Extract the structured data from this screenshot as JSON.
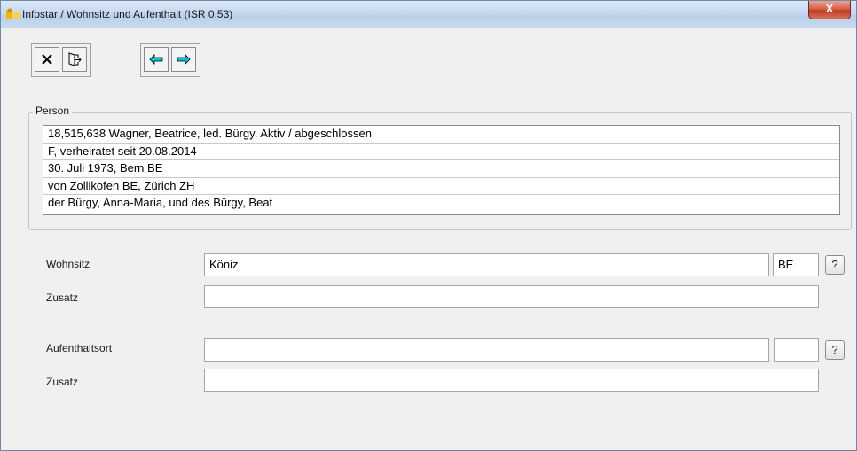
{
  "window": {
    "title": "Infostar / Wohnsitz und Aufenthalt (ISR 0.53)",
    "close_glyph": "X"
  },
  "toolbar": {
    "icons": [
      "close-x-icon",
      "exit-door-icon",
      "arrow-left-icon",
      "arrow-right-icon"
    ],
    "arrow_color": "#00c8d8"
  },
  "person": {
    "legend": "Person",
    "lines": [
      "18,515,638  Wagner, Beatrice, led. Bürgy, Aktiv / abgeschlossen",
      "F, verheiratet seit 20.08.2014",
      "30. Juli 1973, Bern BE",
      "von Zollikofen BE, Zürich ZH",
      "der Bürgy, Anna-Maria, und des Bürgy, Beat"
    ]
  },
  "wohnsitz": {
    "label": "Wohnsitz",
    "value": "Köniz",
    "canton": "BE",
    "help": "?",
    "zusatz_label": "Zusatz",
    "zusatz_value": ""
  },
  "aufenthalt": {
    "label": "Aufenthaltsort",
    "value": "",
    "canton": "",
    "help": "?",
    "zusatz_label": "Zusatz",
    "zusatz_value": ""
  }
}
